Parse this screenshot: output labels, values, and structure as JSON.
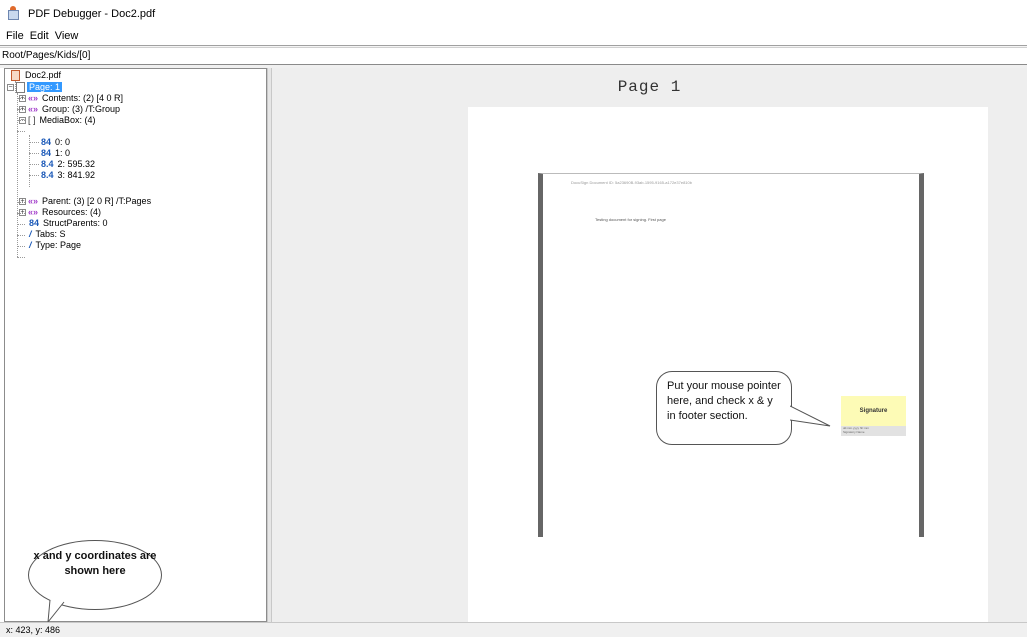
{
  "window": {
    "title": "PDF Debugger -  Doc2.pdf",
    "icon": "java-cup-icon"
  },
  "menu": {
    "items": [
      "File",
      "Edit",
      "View"
    ]
  },
  "path": "Root/Pages/Kids/[0]",
  "tree": {
    "root": "Doc2.pdf",
    "nodes": [
      {
        "label": "Page: 1",
        "icon": "page-icon",
        "selected": true
      },
      {
        "label": "Contents:  (2) [4 0 R]",
        "icon": "dictionary-icon"
      },
      {
        "label": "Group:  (3)   /T:Group",
        "icon": "dictionary-icon"
      },
      {
        "label": "MediaBox:  (4)",
        "icon": "array-icon"
      },
      {
        "label": "0:  0",
        "icon": "integer-icon"
      },
      {
        "label": "1:  0",
        "icon": "integer-icon"
      },
      {
        "label": "2:  595.32",
        "icon": "real-icon"
      },
      {
        "label": "3:  841.92",
        "icon": "real-icon"
      },
      {
        "label": "Parent:  (3) [2 0 R]   /T:Pages",
        "icon": "dictionary-icon"
      },
      {
        "label": "Resources:  (4)",
        "icon": "dictionary-icon"
      },
      {
        "label": "StructParents:  0",
        "icon": "integer-icon"
      },
      {
        "label": "Tabs:  S",
        "icon": "name-icon"
      },
      {
        "label": "Type:  Page",
        "icon": "name-icon"
      }
    ]
  },
  "viewer": {
    "page_label": "Page 1",
    "doc_id": "DocuSign Document ID: 5a23690B-93ab-1595-9165-a172e37e810b",
    "doc_text": "Testing document for signing. First page",
    "signature_label": "Signature",
    "signature_sub_1": "dd.mm.yyyy hh:mm",
    "signature_sub_2": "Signatory Name"
  },
  "annotations": {
    "bubble_pointer": "Put your mouse pointer here, and check x & y in footer section.",
    "bubble_coords": "x and y coordinates are shown here"
  },
  "status": {
    "coords": "x: 423, y: 486"
  }
}
